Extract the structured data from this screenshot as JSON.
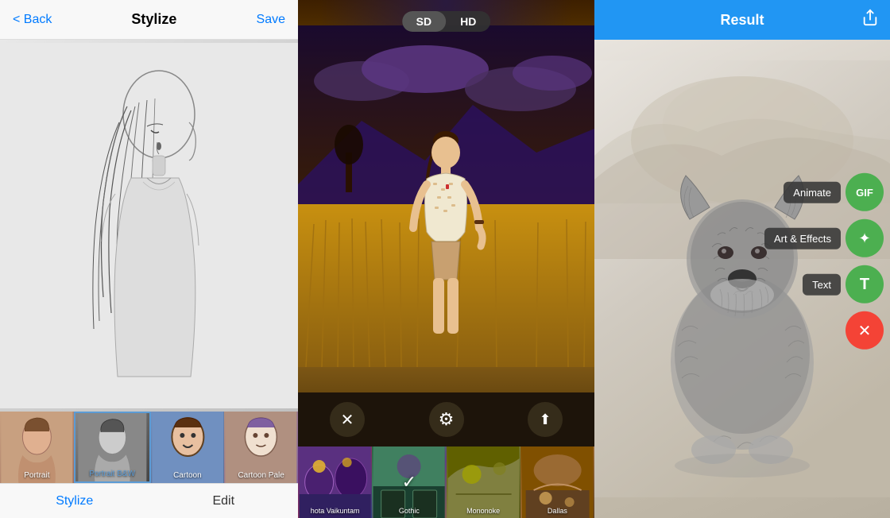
{
  "panel1": {
    "header": {
      "back_label": "< Back",
      "title": "Stylize",
      "save_label": "Save"
    },
    "thumbnails": [
      {
        "label": "Portrait",
        "highlight": false
      },
      {
        "label": "Portrait B&W",
        "highlight": true
      },
      {
        "label": "Cartoon",
        "highlight": false
      },
      {
        "label": "Cartoon Pale",
        "highlight": false
      }
    ],
    "bottom_tabs": [
      {
        "label": "Stylize",
        "active": true
      },
      {
        "label": "Edit",
        "active": false
      }
    ]
  },
  "panel2": {
    "quality_buttons": [
      {
        "label": "SD",
        "active": true
      },
      {
        "label": "HD",
        "active": false
      }
    ],
    "controls": [
      {
        "icon": "✕",
        "name": "close"
      },
      {
        "icon": "⚙",
        "name": "settings"
      },
      {
        "icon": "⬆",
        "name": "share"
      }
    ],
    "filters": [
      {
        "label": "hota Vaikuntam",
        "selected": false
      },
      {
        "label": "Gothic",
        "selected": true
      },
      {
        "label": "Mononoke",
        "selected": false
      },
      {
        "label": "Dallas",
        "selected": false
      }
    ]
  },
  "panel3": {
    "header": {
      "title": "Result",
      "share_icon": "↑"
    },
    "side_actions": [
      {
        "label": "Animate",
        "icon": "GIF",
        "color": "#4CAF50"
      },
      {
        "label": "Art & Effects",
        "icon": "✦",
        "color": "#4CAF50"
      },
      {
        "label": "Text",
        "icon": "T",
        "color": "#4CAF50"
      },
      {
        "label": "",
        "icon": "✕",
        "color": "#f44336"
      }
    ]
  }
}
